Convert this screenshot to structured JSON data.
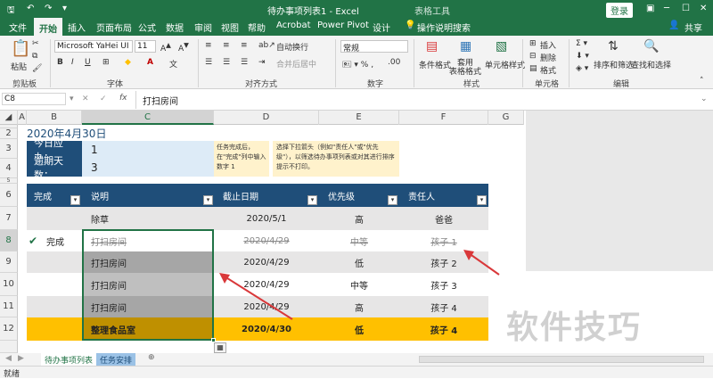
{
  "titlebar": {
    "title": "待办事项列表1 - Excel",
    "tools_label": "表格工具",
    "login_label": "登录"
  },
  "tabs": [
    "文件",
    "开始",
    "插入",
    "页面布局",
    "公式",
    "数据",
    "审阅",
    "视图",
    "帮助",
    "Acrobat",
    "Power Pivot",
    "设计"
  ],
  "tell_me": "操作说明搜索",
  "share": "共享",
  "ribbon": {
    "paste": "粘贴",
    "clipboard": "剪贴板",
    "font_name": "Microsoft YaHei UI",
    "font_size": "11",
    "font_group": "字体",
    "wrap_text": "自动换行",
    "merge_center": "合并后居中",
    "align_group": "对齐方式",
    "number_format": "常规",
    "number_group": "数字",
    "cond_format": "条件格式",
    "table_format": "套用\n表格格式",
    "cell_style": "单元格样式",
    "style_group": "样式",
    "insert": "插入",
    "delete": "删除",
    "format": "格式",
    "cells_group": "单元格",
    "sort_filter": "排序和筛选",
    "find_select": "查找和选择",
    "edit_group": "编辑"
  },
  "formula_bar": {
    "name_box": "C8",
    "fx": "fx",
    "value": "打扫房间"
  },
  "columns": [
    "A",
    "B",
    "C",
    "D",
    "E",
    "F",
    "G"
  ],
  "rows": [
    "1",
    "2",
    "3",
    "4",
    "5",
    "6",
    "7",
    "8",
    "9",
    "10",
    "11",
    "12"
  ],
  "sheet": {
    "date_title": "2020年4月30日",
    "due_today_label": "今日应办：",
    "due_today_value": "1",
    "overdue_label": "逾期天数：",
    "overdue_value": "3",
    "note1": "任务完成后，在\"完成\"列中输入数字 1",
    "note2": "选择下拉箭头（例如\"责任人\"或\"优先级\"），以筛选待办事项列表或对其进行排序提示不打印。",
    "headers": [
      "完成",
      "说明",
      "截止日期",
      "优先级",
      "责任人"
    ],
    "data_rows": [
      {
        "done": "",
        "desc": "除草",
        "date": "2020/5/1",
        "priority": "高",
        "owner": "爸爸"
      },
      {
        "done": "完成",
        "desc": "打扫房间",
        "date": "2020/4/29",
        "priority": "中等",
        "owner": "孩子 1"
      },
      {
        "done": "",
        "desc": "打扫房间",
        "date": "2020/4/29",
        "priority": "低",
        "owner": "孩子 2"
      },
      {
        "done": "",
        "desc": "打扫房间",
        "date": "2020/4/29",
        "priority": "中等",
        "owner": "孩子 3"
      },
      {
        "done": "",
        "desc": "打扫房间",
        "date": "2020/4/29",
        "priority": "高",
        "owner": "孩子 4"
      },
      {
        "done": "",
        "desc": "整理食品室",
        "date": "2020/4/30",
        "priority": "低",
        "owner": "孩子 4"
      }
    ]
  },
  "sheet_tabs": [
    "待办事项列表",
    "任务安排"
  ],
  "status": "就绪",
  "watermark": "软件技巧",
  "colors": {
    "excel_green": "#217346",
    "header_navy": "#1f4e79",
    "gold": "#ffc000",
    "note_yellow": "#fff2cc",
    "light_blue": "#ddebf7",
    "arrow_red": "#d9383a"
  }
}
